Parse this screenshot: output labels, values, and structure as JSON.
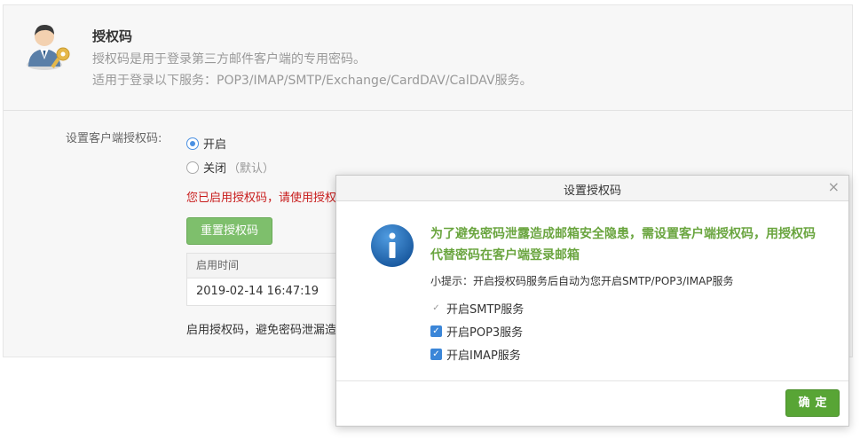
{
  "header": {
    "title": "授权码",
    "line1": "授权码是用于登录第三方邮件客户端的专用密码。",
    "line2": "适用于登录以下服务：POP3/IMAP/SMTP/Exchange/CardDAV/CalDAV服务。"
  },
  "form": {
    "label": "设置客户端授权码:",
    "radio_on": "开启",
    "radio_off": "关闭",
    "radio_off_note": "（默认）",
    "selected": "开启",
    "warning": "您已启用授权码，请使用授权码登录第三方客户端",
    "reset_button": "重置授权码",
    "table_header": "启用时间",
    "table_value": "2019-02-14 16:47:19",
    "bottom_note": "启用授权码，避免密码泄漏造成邮箱安全隐患"
  },
  "dialog": {
    "title": "设置授权码",
    "close_glyph": "×",
    "message": "为了避免密码泄露造成邮箱安全隐患，需设置客户端授权码，用授权码代替密码在客户端登录邮箱",
    "tip": "小提示：开启授权码服务后自动为您开启SMTP/POP3/IMAP服务",
    "options": [
      {
        "label": "开启SMTP服务",
        "checked": true,
        "disabled": true
      },
      {
        "label": "开启POP3服务",
        "checked": true,
        "disabled": false
      },
      {
        "label": "开启IMAP服务",
        "checked": true,
        "disabled": false
      }
    ],
    "ok_button": "确定"
  },
  "icons": {
    "avatar": "user-key-icon",
    "info": "info-icon",
    "close": "close-icon"
  },
  "colors": {
    "accent_green": "#58a535",
    "warning_red": "#c81c1c",
    "message_green": "#6aa53f",
    "info_blue": "#1f6fb5"
  }
}
